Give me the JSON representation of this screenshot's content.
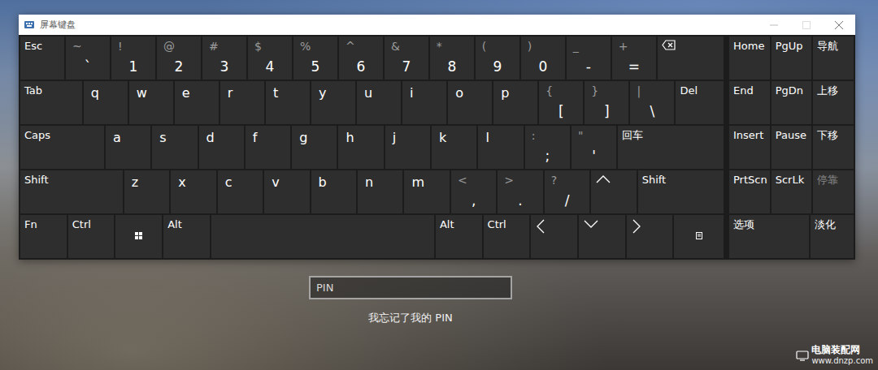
{
  "window": {
    "title": "屏幕键盘"
  },
  "keyboard": {
    "rows": [
      [
        {
          "kind": "label",
          "label": "Esc"
        },
        {
          "kind": "dual",
          "shift": "~",
          "main": "`"
        },
        {
          "kind": "dual",
          "shift": "!",
          "main": "1"
        },
        {
          "kind": "dual",
          "shift": "@",
          "main": "2"
        },
        {
          "kind": "dual",
          "shift": "#",
          "main": "3"
        },
        {
          "kind": "dual",
          "shift": "$",
          "main": "4"
        },
        {
          "kind": "dual",
          "shift": "%",
          "main": "5"
        },
        {
          "kind": "dual",
          "shift": "^",
          "main": "6"
        },
        {
          "kind": "dual",
          "shift": "&",
          "main": "7"
        },
        {
          "kind": "dual",
          "shift": "*",
          "main": "8"
        },
        {
          "kind": "dual",
          "shift": "(",
          "main": "9"
        },
        {
          "kind": "dual",
          "shift": ")",
          "main": "0"
        },
        {
          "kind": "dual",
          "shift": "_",
          "main": "-"
        },
        {
          "kind": "dual",
          "shift": "+",
          "main": "="
        },
        {
          "kind": "icon",
          "icon": "backspace"
        }
      ],
      [
        {
          "kind": "label",
          "label": "Tab"
        },
        {
          "kind": "letter",
          "label": "q"
        },
        {
          "kind": "letter",
          "label": "w"
        },
        {
          "kind": "letter",
          "label": "e"
        },
        {
          "kind": "letter",
          "label": "r"
        },
        {
          "kind": "letter",
          "label": "t"
        },
        {
          "kind": "letter",
          "label": "y"
        },
        {
          "kind": "letter",
          "label": "u"
        },
        {
          "kind": "letter",
          "label": "i"
        },
        {
          "kind": "letter",
          "label": "o"
        },
        {
          "kind": "letter",
          "label": "p"
        },
        {
          "kind": "dual",
          "shift": "{",
          "main": "["
        },
        {
          "kind": "dual",
          "shift": "}",
          "main": "]"
        },
        {
          "kind": "dual",
          "shift": "|",
          "main": "\\"
        },
        {
          "kind": "label",
          "label": "Del"
        }
      ],
      [
        {
          "kind": "label",
          "label": "Caps"
        },
        {
          "kind": "letter",
          "label": "a"
        },
        {
          "kind": "letter",
          "label": "s"
        },
        {
          "kind": "letter",
          "label": "d"
        },
        {
          "kind": "letter",
          "label": "f"
        },
        {
          "kind": "letter",
          "label": "g"
        },
        {
          "kind": "letter",
          "label": "h"
        },
        {
          "kind": "letter",
          "label": "j"
        },
        {
          "kind": "letter",
          "label": "k"
        },
        {
          "kind": "letter",
          "label": "l"
        },
        {
          "kind": "dual",
          "shift": ":",
          "main": ";"
        },
        {
          "kind": "dual",
          "shift": "\"",
          "main": "'"
        },
        {
          "kind": "label",
          "label": "回车"
        }
      ],
      [
        {
          "kind": "label",
          "label": "Shift"
        },
        {
          "kind": "letter",
          "label": "z"
        },
        {
          "kind": "letter",
          "label": "x"
        },
        {
          "kind": "letter",
          "label": "c"
        },
        {
          "kind": "letter",
          "label": "v"
        },
        {
          "kind": "letter",
          "label": "b"
        },
        {
          "kind": "letter",
          "label": "n"
        },
        {
          "kind": "letter",
          "label": "m"
        },
        {
          "kind": "dual",
          "shift": "<",
          "main": ","
        },
        {
          "kind": "dual",
          "shift": ">",
          "main": "."
        },
        {
          "kind": "dual",
          "shift": "?",
          "main": "/"
        },
        {
          "kind": "arrow",
          "direction": "up"
        },
        {
          "kind": "label",
          "label": "Shift"
        }
      ],
      [
        {
          "kind": "label",
          "label": "Fn"
        },
        {
          "kind": "label",
          "label": "Ctrl"
        },
        {
          "kind": "icon",
          "icon": "windows"
        },
        {
          "kind": "label",
          "label": "Alt"
        },
        {
          "kind": "space"
        },
        {
          "kind": "label",
          "label": "Alt"
        },
        {
          "kind": "label",
          "label": "Ctrl"
        },
        {
          "kind": "arrow",
          "direction": "left"
        },
        {
          "kind": "arrow",
          "direction": "down"
        },
        {
          "kind": "arrow",
          "direction": "right"
        },
        {
          "kind": "icon",
          "icon": "menu"
        }
      ]
    ],
    "side_rows": [
      [
        {
          "label": "Home",
          "disabled": false
        },
        {
          "label": "PgUp",
          "disabled": false
        },
        {
          "label": "导航",
          "disabled": false
        }
      ],
      [
        {
          "label": "End",
          "disabled": false
        },
        {
          "label": "PgDn",
          "disabled": false
        },
        {
          "label": "上移",
          "disabled": false
        }
      ],
      [
        {
          "label": "Insert",
          "disabled": false
        },
        {
          "label": "Pause",
          "disabled": false
        },
        {
          "label": "下移",
          "disabled": false
        }
      ],
      [
        {
          "label": "PrtScn",
          "disabled": false
        },
        {
          "label": "ScrLk",
          "disabled": false
        },
        {
          "label": "停靠",
          "disabled": true
        }
      ],
      [
        {
          "label": "选项",
          "disabled": false
        },
        {
          "label": "淡化",
          "disabled": false
        }
      ]
    ]
  },
  "login": {
    "pin_placeholder": "PIN",
    "forgot_link": "我忘记了我的 PIN"
  },
  "watermark": {
    "title": "电脑装配网",
    "url": "www.dnzp.com"
  }
}
